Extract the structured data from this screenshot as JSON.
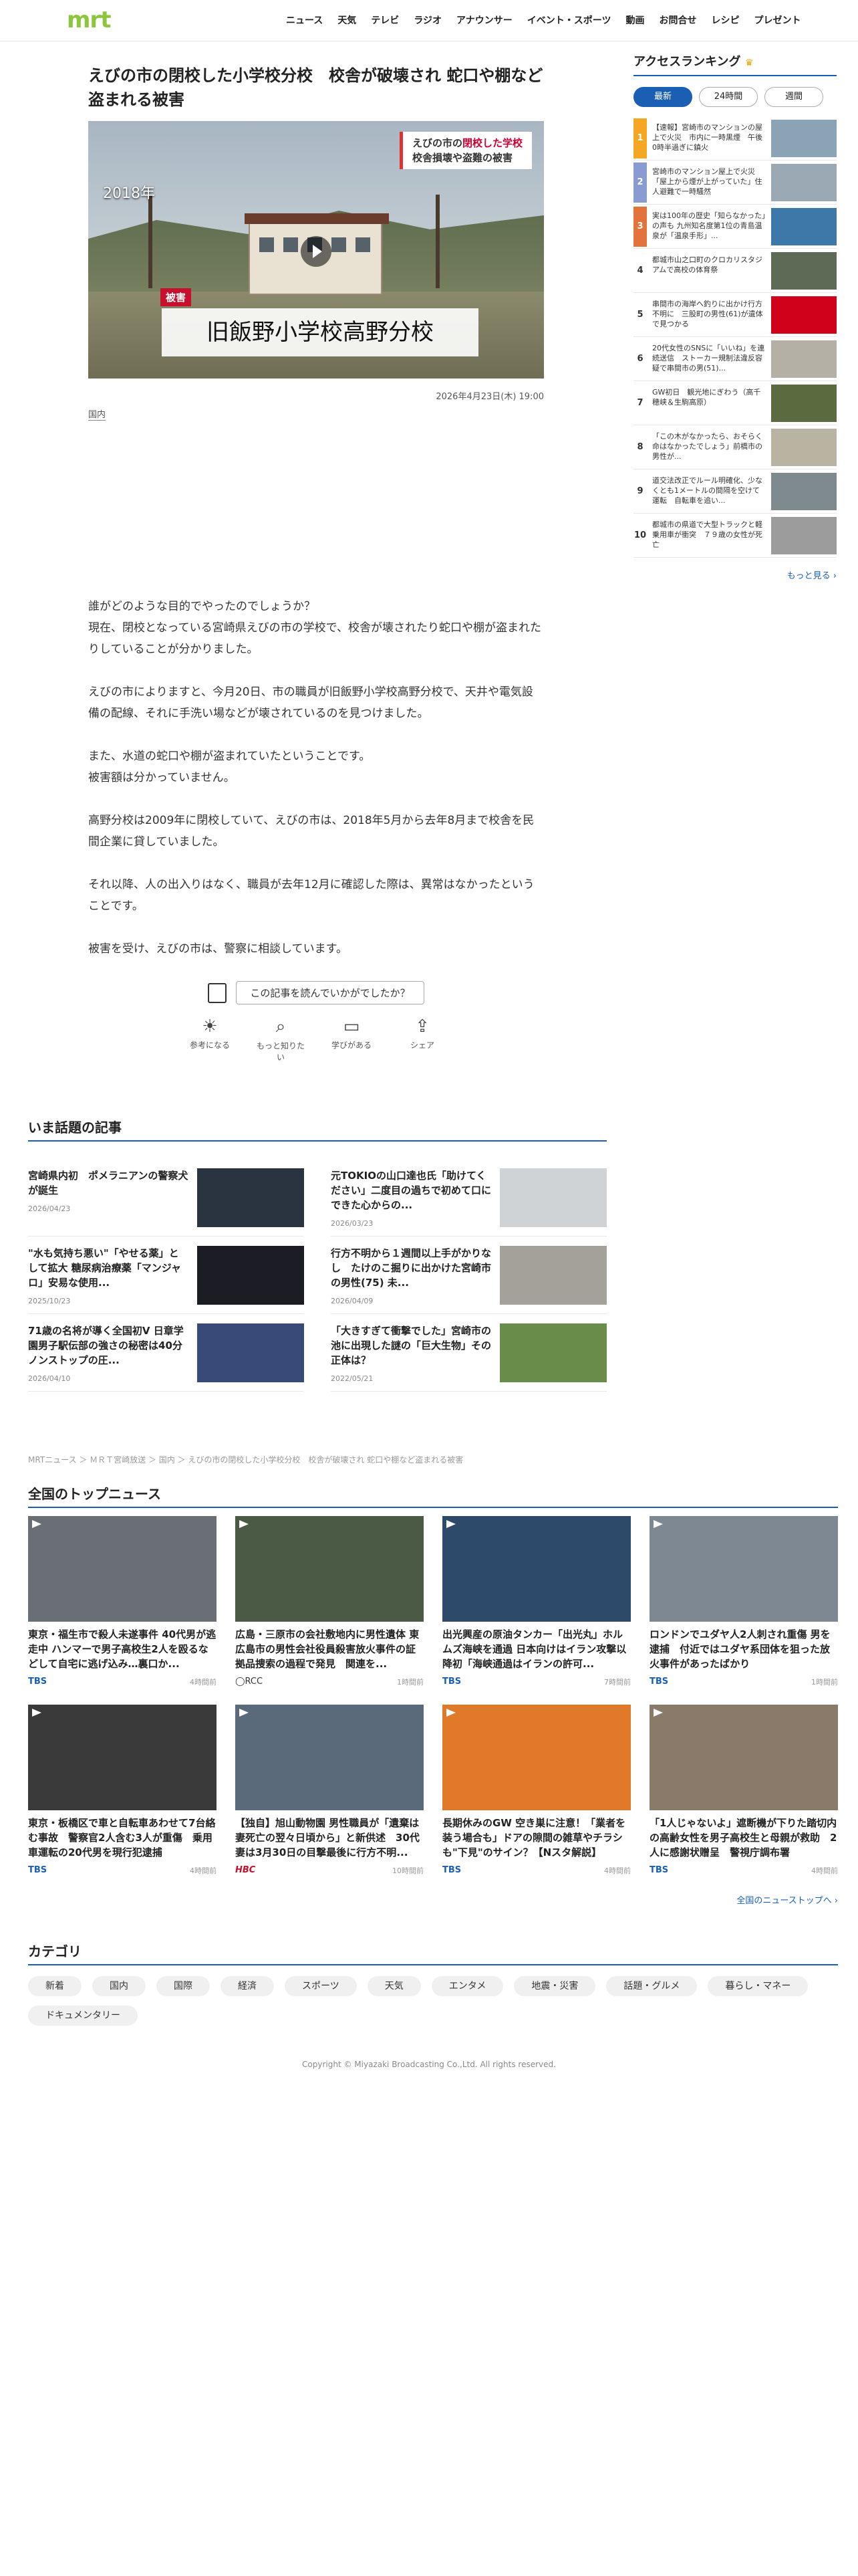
{
  "header": {
    "logo": "mrt",
    "nav": [
      "ニュース",
      "天気",
      "テレビ",
      "ラジオ",
      "アナウンサー",
      "イベント・スポーツ",
      "動画",
      "お問合せ",
      "レシピ",
      "プレゼント"
    ]
  },
  "article": {
    "title": "えびの市の閉校した小学校分校　校舎が破壊され 蛇口や棚など盗まれる被害",
    "hero": {
      "year": "2018年",
      "caption_line1_a": "えびの市の",
      "caption_line1_b": "閉校した学校",
      "caption_line2": "校舎損壊や盗難の被害",
      "tag": "被害",
      "band": "旧飯野小学校高野分校"
    },
    "date": "2026年4月23日(木) 19:00",
    "category": "国内",
    "paragraphs": [
      [
        "誰がどのような目的でやったのでしょうか？",
        "現在、閉校となっている宮崎県えびの市の学校で、校舎が壊されたり蛇口や棚が盗まれたりしていることが分かりました。"
      ],
      [
        "えびの市によりますと、今月20日、市の職員が旧飯野小学校高野分校で、天井や電気設備の配線、それに手洗い場などが壊されているのを見つけました。"
      ],
      [
        "また、水道の蛇口や棚が盗まれていたということです。",
        "被害額は分かっていません。"
      ],
      [
        "高野分校は2009年に閉校していて、えびの市は、2018年5月から去年8月まで校舎を民間企業に貸していました。"
      ],
      [
        "それ以降、人の出入りはなく、職員が去年12月に確認した際は、異常はなかったということです。"
      ],
      [
        "被害を受け、えびの市は、警察に相談しています。"
      ]
    ],
    "feedback_question": "この記事を読んでいかがでしたか？",
    "reactions": [
      {
        "icon": "lightbulb-icon",
        "label": "参考になる"
      },
      {
        "icon": "search-icon",
        "label": "もっと知りたい"
      },
      {
        "icon": "book-icon",
        "label": "学びがある"
      },
      {
        "icon": "share-icon",
        "label": "シェア"
      }
    ]
  },
  "sidebar": {
    "title": "アクセスランキング",
    "tabs": [
      "最新",
      "24時間",
      "週間"
    ],
    "ranking": [
      {
        "n": "1",
        "text": "【速報】宮崎市のマンションの屋上で火災　市内に一時黒煙　午後0時半過ぎに鎮火",
        "color": "#8aa4b5"
      },
      {
        "n": "2",
        "text": "宮崎市のマンション屋上で火災「屋上から煙が上がっていた」住人避難で一時騒然",
        "color": "#9aa9b4"
      },
      {
        "n": "3",
        "text": "実は100年の歴史「知らなかった」の声も 九州知名度第1位の青島温泉が「温泉手形」...",
        "color": "#3e78a8"
      },
      {
        "n": "4",
        "text": "都城市山之口町のクロカリスタジアムで高校の体育祭",
        "color": "#5d6a55"
      },
      {
        "n": "5",
        "text": "串間市の海岸へ釣りに出かけ行方不明に　三股町の男性(61)が遺体で見つかる",
        "color": "#d0021b"
      },
      {
        "n": "6",
        "text": "20代女性のSNSに「いいね」を連続送信　ストーカー規制法違反容疑で串間市の男(51)...",
        "color": "#b5b0a5"
      },
      {
        "n": "7",
        "text": "GW初日　観光地にぎわう（高千穂峡＆生駒高原）",
        "color": "#5b6b3f"
      },
      {
        "n": "8",
        "text": "「この木がなかったら、おそらく命はなかったでしょう」前橋市の男性が...",
        "color": "#b9b4a2"
      },
      {
        "n": "9",
        "text": "道交法改正でルール明確化、少なくとも1メートルの間隔を空けて運転　自転車を追い...",
        "color": "#7f8a8e"
      },
      {
        "n": "10",
        "text": "都城市の県道で大型トラックと軽乗用車が衝突　７９歳の女性が死亡",
        "color": "#9c9c9c"
      }
    ],
    "more": "もっと見る ›"
  },
  "trending": {
    "title": "いま話題の記事",
    "items": [
      {
        "text": "宮崎県内初　ポメラニアンの警察犬が誕生",
        "date": "2026/04/23",
        "color": "#2a3440"
      },
      {
        "text": "元TOKIOの山口達也氏「助けてください」二度目の過ちで初めて口にできた心からの...",
        "date": "2026/03/23",
        "color": "#cfd3d6"
      },
      {
        "text": "\"水も気持ち悪い\"「やせる薬」として拡大 糖尿病治療薬「マンジャロ」安易な使用...",
        "date": "2025/10/23",
        "color": "#1c1c24"
      },
      {
        "text": "行方不明から１週間以上手がかりなし　たけのこ掘りに出かけた宮崎市の男性(75) 未...",
        "date": "2026/04/09",
        "color": "#a4a09a"
      },
      {
        "text": "71歳の名将が導く全国初V 日章学園男子駅伝部の強さの秘密は40分ノンストップの圧...",
        "date": "2026/04/10",
        "color": "#3a4a78"
      },
      {
        "text": "「大きすぎて衝撃でした」宮崎市の池に出現した謎の「巨大生物」その正体は？",
        "date": "2022/05/21",
        "color": "#6a8c4a"
      }
    ]
  },
  "breadcrumb": "MRTニュース ＞ ＭＲＴ宮崎放送 ＞ 国内 ＞ えびの市の閉校した小学校分校　校舎が破壊され 蛇口や棚など盗まれる被害",
  "topnews": {
    "title": "全国のトップニュース",
    "items": [
      {
        "text": "東京・福生市で殺人未遂事件 40代男が逃走中 ハンマーで男子高校生2人を殴るなどして自宅に逃げ込み…裏口か...",
        "src": "TBS",
        "time": "4時間前",
        "cls": "",
        "color": "#6a6f75"
      },
      {
        "text": "広島・三原市の会社敷地内に男性遺体 東広島市の男性会社役員殺害放火事件の証拠品捜索の過程で発見　関連を...",
        "src": "◯RCC",
        "time": "1時間前",
        "cls": "rcc",
        "color": "#4a5a44"
      },
      {
        "text": "出光興産の原油タンカー「出光丸」ホルムズ海峡を通過 日本向けはイラン攻撃以降初「海峡通過はイランの許可...",
        "src": "TBS",
        "time": "7時間前",
        "cls": "",
        "color": "#2d4a6a"
      },
      {
        "text": "ロンドンでユダヤ人2人刺され重傷 男を逮捕　付近ではユダヤ系団体を狙った放火事件があったばかり",
        "src": "TBS",
        "time": "1時間前",
        "cls": "",
        "color": "#7e8892"
      },
      {
        "text": "東京・板橋区で車と自転車あわせて7台絡む事故　警察官2人含む3人が重傷　乗用車運転の20代男を現行犯逮捕",
        "src": "TBS",
        "time": "4時間前",
        "cls": "",
        "color": "#3a3a3a"
      },
      {
        "text": "【独自】旭山動物園 男性職員が「遺棄は妻死亡の翌々日頃から」と新供述　30代妻は3月30日の目撃最後に行方不明...",
        "src": "HBC",
        "time": "10時間前",
        "cls": "hbc",
        "color": "#5a6a7a"
      },
      {
        "text": "長期休みのGW 空き巣に注意！「業者を装う場合も」ドアの隙間の雑草やチラシも\"下見\"のサイン？【Nスタ解説】",
        "src": "TBS",
        "time": "4時間前",
        "cls": "",
        "color": "#e07a2a"
      },
      {
        "text": "「1人じゃないよ」遮断機が下りた踏切内の高齢女性を男子高校生と母親が救助　2人に感謝状贈呈　警視庁調布署",
        "src": "TBS",
        "time": "4時間前",
        "cls": "",
        "color": "#8a7a6a"
      }
    ],
    "more": "全国のニューストップへ ›"
  },
  "categories": {
    "title": "カテゴリ",
    "items": [
      "新着",
      "国内",
      "国際",
      "経済",
      "スポーツ",
      "天気",
      "エンタメ",
      "地震・災害",
      "話題・グルメ",
      "暮らし・マネー",
      "ドキュメンタリー"
    ]
  },
  "copyright": "Copyright © Miyazaki Broadcasting Co.,Ltd. All rights reserved."
}
